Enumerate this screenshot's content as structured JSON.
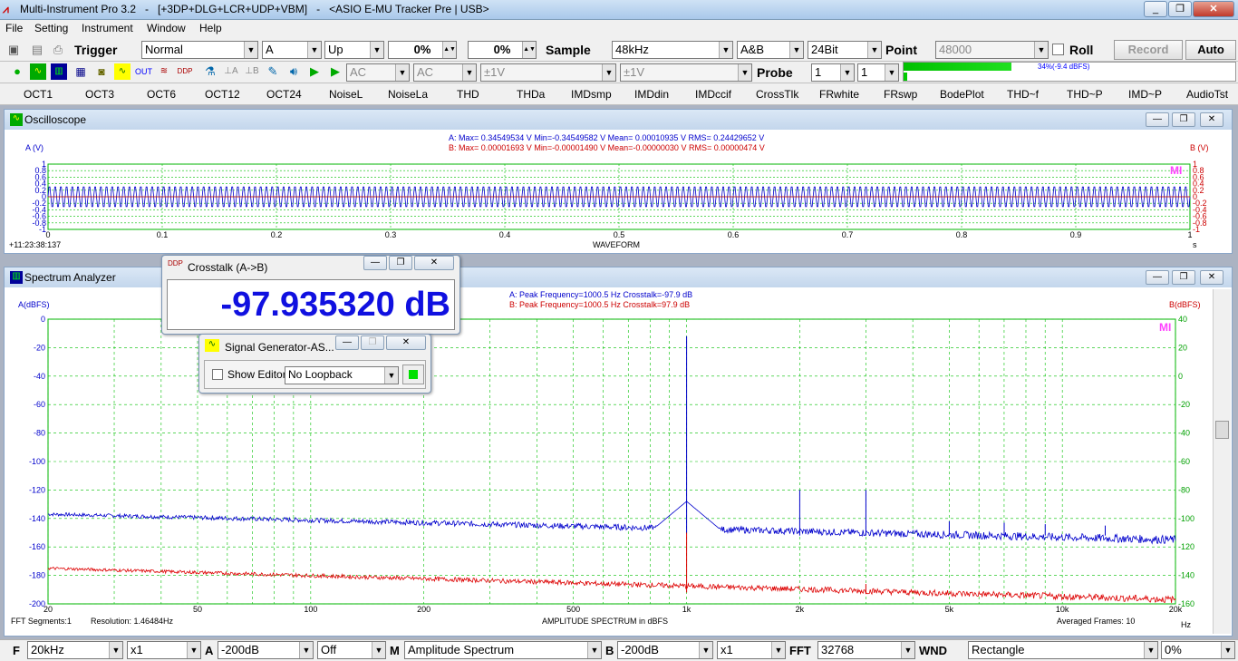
{
  "window": {
    "title": "Multi-Instrument Pro 3.2   -   [+3DP+DLG+LCR+UDP+VBM]   -   <ASIO E-MU Tracker Pre | USB>"
  },
  "menu": [
    "File",
    "Setting",
    "Instrument",
    "Window",
    "Help"
  ],
  "toolbar1": {
    "trigger_label": "Trigger",
    "trigger_mode": "Normal",
    "trigger_channel": "A",
    "trigger_edge": "Up",
    "trigger_level": "0%",
    "trigger_delay": "0%",
    "sample_label": "Sample",
    "sample_rate": "48kHz",
    "channels": "A&B",
    "bits": "24Bit",
    "point_label": "Point",
    "points": "48000",
    "roll_label": "Roll",
    "record_label": "Record",
    "auto_label": "Auto"
  },
  "toolbar2": {
    "coupling_a": "AC",
    "coupling_b": "AC",
    "range_a": "±1V",
    "range_b": "±1V",
    "probe_label": "Probe",
    "probe_a": "1",
    "probe_b": "1",
    "level_text": "34%(-9.4 dBFS)",
    "level_fraction": 0.34
  },
  "modules": [
    "OCT1",
    "OCT3",
    "OCT6",
    "OCT12",
    "OCT24",
    "NoiseL",
    "NoiseLa",
    "THD",
    "THDa",
    "IMDsmp",
    "IMDdin",
    "IMDccif",
    "CrossTlk",
    "FRwhite",
    "FRswp",
    "BodePlot",
    "THD~f",
    "THD~P",
    "IMD~P",
    "AudioTst"
  ],
  "oscilloscope": {
    "title": "Oscilloscope",
    "stats_a": "A: Max= 0.34549534 V  Min=-0.34549582 V  Mean= 0.00010935 V  RMS= 0.24429652 V",
    "stats_b": "B: Max= 0.00001693 V  Min=-0.00001490 V  Mean=-0.00000030 V  RMS= 0.00000474 V",
    "ylabel_a": "A (V)",
    "ylabel_b": "B (V)",
    "yticks": [
      "1",
      "0.8",
      "0.6",
      "0.4",
      "0.2",
      "0",
      "-0.2",
      "-0.4",
      "-0.6",
      "-0.8",
      "-1"
    ],
    "xticks": [
      "0",
      "0.1",
      "0.2",
      "0.3",
      "0.4",
      "0.5",
      "0.6",
      "0.7",
      "0.8",
      "0.9",
      "1"
    ],
    "xunit": "s",
    "timestamp": "+11:23:38:137",
    "xtitle": "WAVEFORM",
    "logo": "MI"
  },
  "spectrum": {
    "title": "Spectrum Analyzer",
    "peak_a": "A: Peak Frequency=1000.5 Hz  Crosstalk=-97.9 dB",
    "peak_b": "B: Peak Frequency=1000.5 Hz  Crosstalk=97.9 dB",
    "ylabel_a": "A(dBFS)",
    "ylabel_b": "B(dBFS)",
    "yticks_a": [
      "0",
      "-20",
      "-40",
      "-60",
      "-80",
      "-100",
      "-120",
      "-140",
      "-160",
      "-180",
      "-200"
    ],
    "yticks_b": [
      "40",
      "20",
      "0",
      "-20",
      "-40",
      "-60",
      "-80",
      "-100",
      "-120",
      "-140",
      "-160"
    ],
    "xticks": [
      "20",
      "50",
      "100",
      "200",
      "500",
      "1k",
      "2k",
      "5k",
      "10k",
      "20k"
    ],
    "xunit": "Hz",
    "fft_segments": "FFT Segments:1",
    "resolution": "Resolution: 1.46484Hz",
    "xtitle": "AMPLITUDE SPECTRUM in dBFS",
    "averaged": "Averaged Frames: 10",
    "logo": "MI"
  },
  "crosstalk_window": {
    "title": "Crosstalk (A->B)",
    "value": "-97.935320 dB"
  },
  "siggen_window": {
    "title": "Signal Generator-AS...",
    "show_editor": "Show Editor",
    "loopback": "No Loopback"
  },
  "statusbar": {
    "f_label": "F",
    "f_value": "20kHz",
    "f_zoom": "x1",
    "a_label": "A",
    "a_value": "-200dB",
    "a_mode": "Off",
    "m_label": "M",
    "m_value": "Amplitude Spectrum",
    "b_label": "B",
    "b_value": "-200dB",
    "b_zoom": "x1",
    "fft_label": "FFT",
    "fft_value": "32768",
    "wnd_label": "WND",
    "wnd_value": "Rectangle",
    "overlap": "0%"
  },
  "colors": {
    "channel_a": "#0000cc",
    "channel_b": "#dd0000",
    "grid": "#00cc00"
  }
}
